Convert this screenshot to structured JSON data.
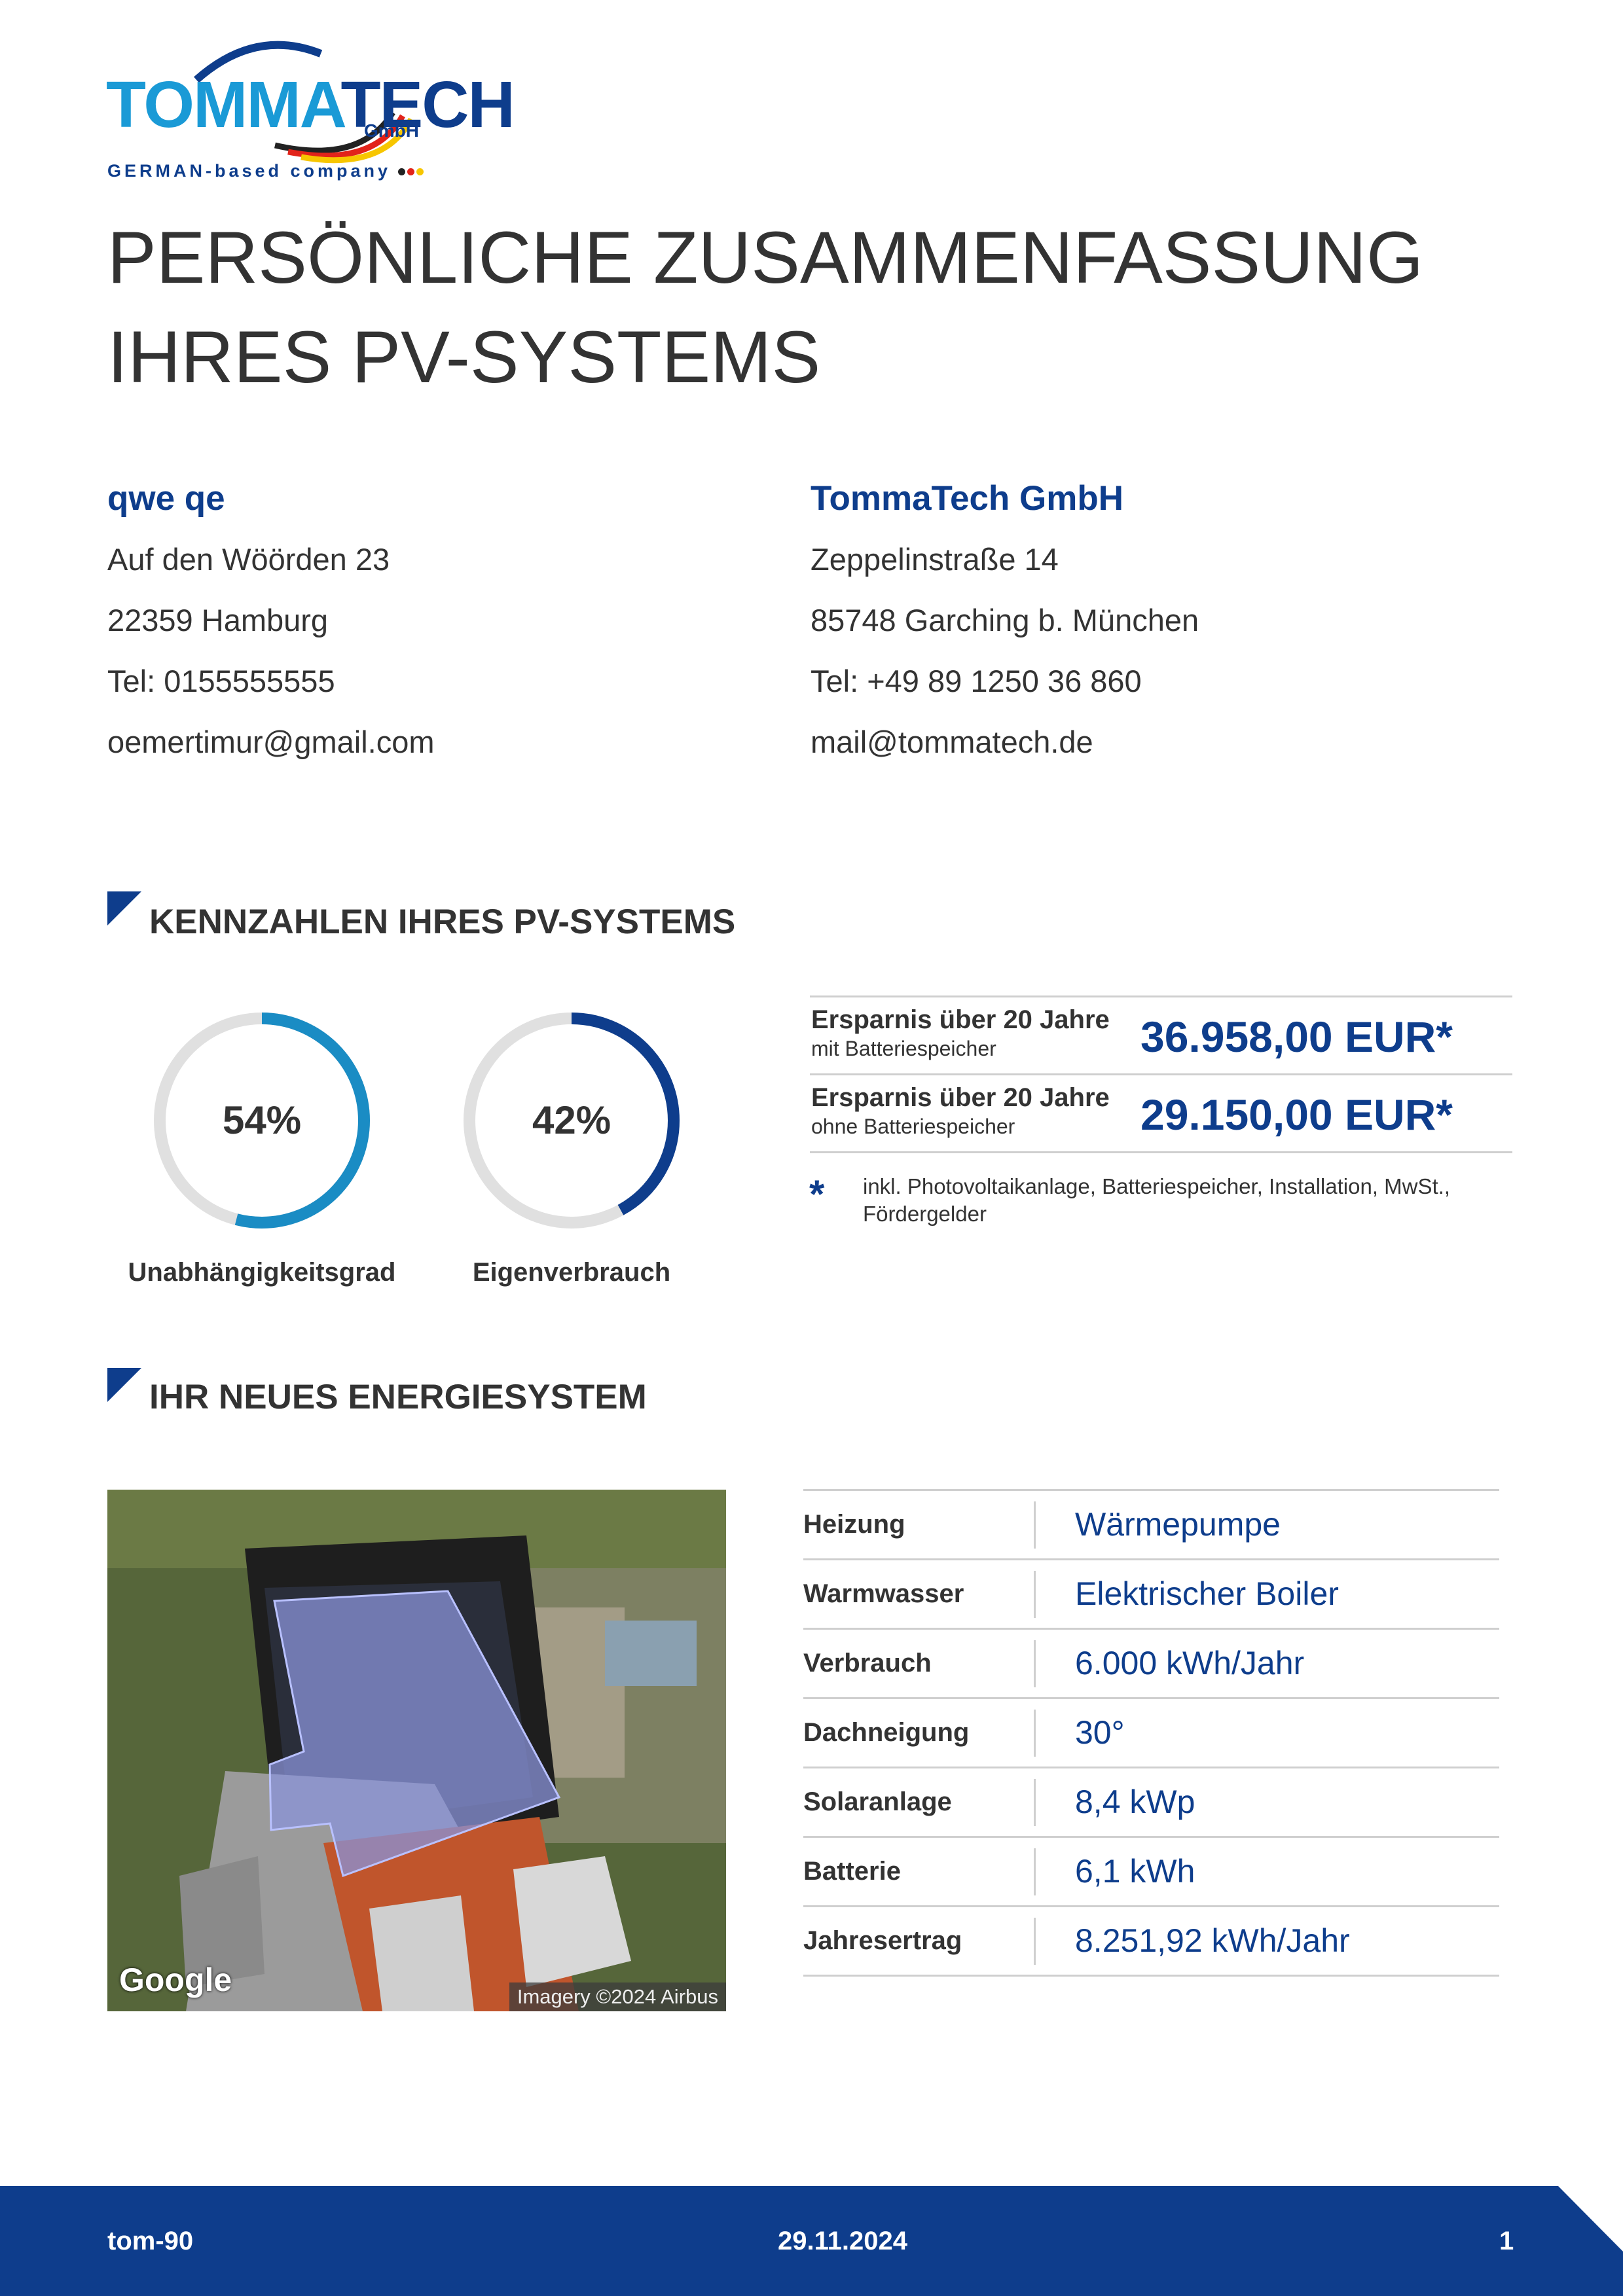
{
  "logo": {
    "brand_part1": "TOMMA",
    "brand_part2": "TECH",
    "suffix": "GmbH",
    "tagline": "GERMAN-based company"
  },
  "title": {
    "line1": "PERSÖNLICHE ZUSAMMENFASSUNG",
    "line2": "IHRES PV-SYSTEMS"
  },
  "customer": {
    "name": "qwe qe",
    "street": "Auf den Wöörden 23",
    "city": "22359 Hamburg",
    "phone": "Tel: 0155555555",
    "email": "oemertimur@gmail.com"
  },
  "company": {
    "name": "TommaTech GmbH",
    "street": "Zeppelinstraße 14",
    "city": "85748 Garching b. München",
    "phone": "Tel: +49 89 1250 36 860",
    "email": "mail@tommatech.de"
  },
  "kpi": {
    "heading": "KENNZAHLEN IHRES PV-SYSTEMS",
    "independence": {
      "value": 54,
      "text": "54%",
      "label": "Unabhängigkeitsgrad",
      "color": "#1a8cc4"
    },
    "self_consumption": {
      "value": 42,
      "text": "42%",
      "label": "Eigenverbrauch",
      "color": "#0e3d8c"
    },
    "track_color": "#e0e0e0"
  },
  "savings": {
    "rows": [
      {
        "title": "Ersparnis über 20 Jahre",
        "subtitle": "mit Batteriespeicher",
        "value": "36.958,00 EUR*"
      },
      {
        "title": "Ersparnis über 20 Jahre",
        "subtitle": "ohne Batteriespeicher",
        "value": "29.150,00 EUR*"
      }
    ],
    "note_marker": "*",
    "note": "inkl. Photovoltaikanlage, Batteriespeicher, Installation, MwSt., Fördergelder"
  },
  "energy": {
    "heading": "IHR NEUES ENERGIESYSTEM",
    "map": {
      "google_label": "Google",
      "credit": "Imagery ©2024 Airbus"
    },
    "rows": [
      {
        "label": "Heizung",
        "value": "Wärmepumpe"
      },
      {
        "label": "Warmwasser",
        "value": "Elektrischer Boiler"
      },
      {
        "label": "Verbrauch",
        "value": "6.000 kWh/Jahr"
      },
      {
        "label": "Dachneigung",
        "value": "30°"
      },
      {
        "label": "Solaranlage",
        "value": "8,4 kWp"
      },
      {
        "label": "Batterie",
        "value": "6,1 kWh"
      },
      {
        "label": "Jahresertrag",
        "value": "8.251,92 kWh/Jahr"
      }
    ]
  },
  "footer": {
    "ref": "tom-90",
    "date": "29.11.2024",
    "page": "1",
    "color": "#0e3d8c"
  }
}
